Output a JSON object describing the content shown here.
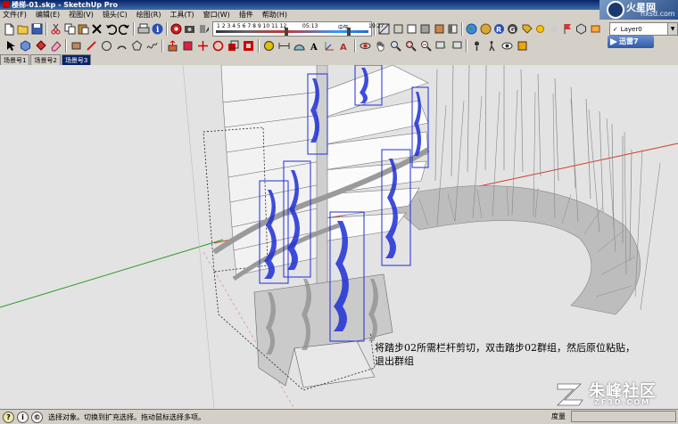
{
  "window": {
    "title": "楼梯-01.skp - SketchUp Pro"
  },
  "brand": {
    "line1": "火星网",
    "line2": "hxsd.com"
  },
  "menu": [
    "文件(F)",
    "编辑(E)",
    "视图(V)",
    "镜头(C)",
    "绘图(R)",
    "工具(T)",
    "窗口(W)",
    "插件",
    "帮助(H)"
  ],
  "shadow_strip": {
    "months": "1 2 3 4 5 6 7 8 9 10 11 12",
    "start_time": "05:13",
    "noon": "中午",
    "end_time": "19:27"
  },
  "layer": {
    "current": "Layer0"
  },
  "login_button": {
    "label": "迅雷7"
  },
  "scene_tabs": [
    {
      "label": "场景号1",
      "active": false
    },
    {
      "label": "场景号2",
      "active": false
    },
    {
      "label": "场景号3",
      "active": true
    }
  ],
  "caption": {
    "line1": "将踏步02所需栏杆剪切，双击踏步02群组，然后原位粘贴，",
    "line2": "退出群组"
  },
  "watermark": {
    "cn": "朱峰社区",
    "en": "ZF3D.COM"
  },
  "status": {
    "message": "选择对象。切换到扩充选择。拖动鼠标选择多项。",
    "measure_label": "度量",
    "measure_value": ""
  },
  "colors": {
    "accent": "#0a246a",
    "selection": "#1f2fd6",
    "axis_red": "#d23a2a",
    "axis_green": "#2a9a2a",
    "viewport_bg": "#e3e3e3"
  },
  "toolbar1_icons": [
    "new-file-icon",
    "open-file-icon",
    "save-icon",
    "cut-icon",
    "copy-icon",
    "paste-icon",
    "erase-icon",
    "undo-icon",
    "redo-icon",
    "print-icon",
    "info-icon",
    "camera-icon",
    "scene-icon",
    "shadow-toggle-icon"
  ],
  "toolbar2_icons": [
    "select-icon",
    "make-component-icon",
    "paint-bucket-icon",
    "eraser-icon",
    "rectangle-icon",
    "line-icon",
    "circle-icon",
    "arc-icon",
    "polygon-icon",
    "freehand-icon",
    "push-pull-icon",
    "follow-me-icon",
    "move-icon",
    "rotate-icon",
    "scale-icon",
    "offset-icon",
    "tape-measure-icon",
    "dimension-icon",
    "protractor-icon",
    "text-icon",
    "axes-icon",
    "3d-text-icon",
    "orbit-icon",
    "pan-icon",
    "zoom-icon",
    "zoom-window-icon",
    "zoom-extents-icon",
    "previous-view-icon",
    "next-view-icon",
    "position-camera-icon",
    "walk-icon",
    "look-around-icon",
    "section-plane-icon"
  ]
}
